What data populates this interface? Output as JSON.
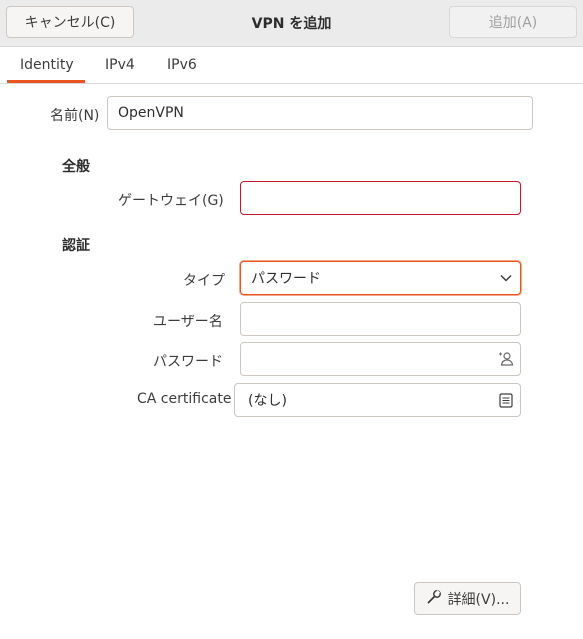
{
  "header": {
    "cancel_label": "キャンセル(C)",
    "title": "VPN を追加",
    "add_label": "追加(A)"
  },
  "tabs": [
    {
      "label": "Identity",
      "active": true
    },
    {
      "label": "IPv4",
      "active": false
    },
    {
      "label": "IPv6",
      "active": false
    }
  ],
  "form": {
    "name_label": "名前(N)",
    "name_value": "OpenVPN",
    "general_section": "全般",
    "gateway_label": "ゲートウェイ(G)",
    "gateway_value": "",
    "auth_section": "認証",
    "type_label": "タイプ",
    "type_value": "パスワード",
    "username_label": "ユーザー名",
    "username_value": "",
    "password_label": "パスワード",
    "password_value": "",
    "ca_label": "CA certificate",
    "ca_value": "(なし)"
  },
  "footer": {
    "advanced_label": "詳細(V)..."
  },
  "colors": {
    "accent": "#e95420",
    "error": "#c7162b"
  }
}
